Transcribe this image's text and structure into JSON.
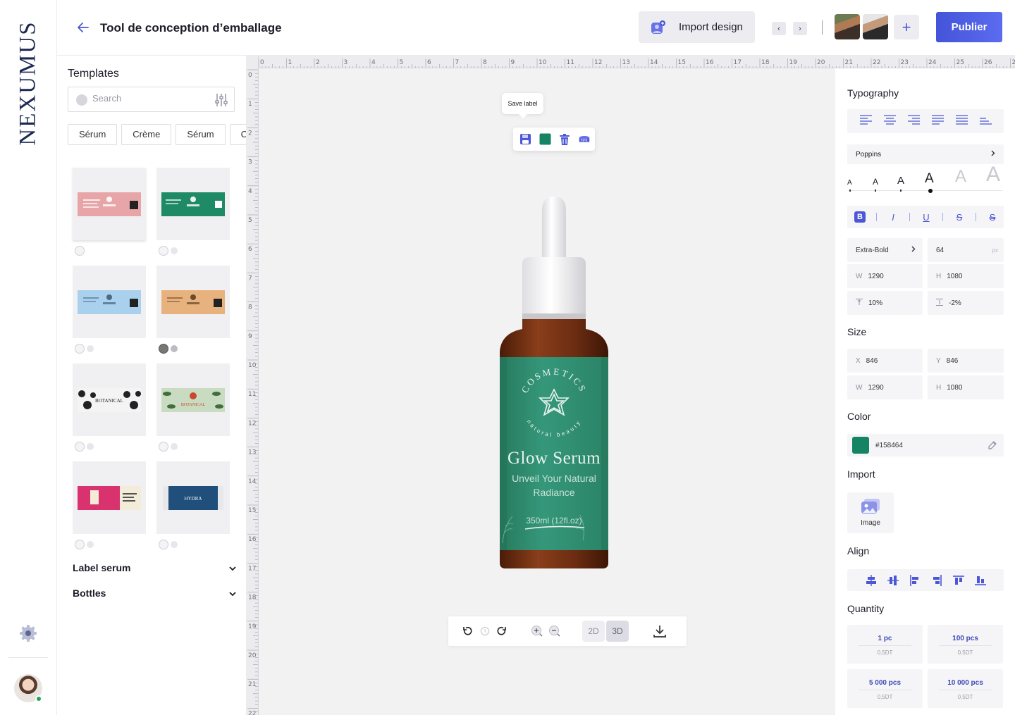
{
  "brand": {
    "logo_text": "NEXUMUS"
  },
  "header": {
    "title": "Tool de conception d’emballage",
    "import_label": "Import design",
    "prev_label": "‹",
    "next_label": "›",
    "add_label": "+",
    "publish_label": "Publier"
  },
  "templates": {
    "title": "Templates",
    "search_placeholder": "Search",
    "chips": [
      "Sérum",
      "Crème",
      "Sérum",
      "Crème"
    ],
    "cards": [
      {
        "color": "#e8a5a8"
      },
      {
        "color": "#1f8b66"
      },
      {
        "color": "#a9d0ec"
      },
      {
        "color": "#e8b27e"
      },
      {
        "color": "#f4f4f4",
        "text": "BOTANICAL"
      },
      {
        "color": "#c9dcc1",
        "text": "BOTANICAL"
      },
      {
        "color": "#d8336e"
      },
      {
        "color": "#1f4f7a",
        "text": "HYDRA"
      }
    ],
    "accordions": [
      {
        "label": "Label serum"
      },
      {
        "label": "Bottles"
      }
    ]
  },
  "ruler": {
    "top_max": 27,
    "left_max": 22
  },
  "canvas": {
    "tooltip": "Save label",
    "label": {
      "brand_arc": "COSMETICS",
      "tagline_arc": "natural beauty",
      "title": "Glow Serum",
      "subtitle_line1": "Unveil Your Natural",
      "subtitle_line2": "Radiance",
      "volume": "350ml (12fl.oz)"
    },
    "view_modes": {
      "two_d": "2D",
      "three_d": "3D",
      "active": "3D"
    }
  },
  "properties": {
    "typography": {
      "title": "Typography",
      "font_family": "Poppins",
      "size_letter": "A",
      "selected_size_index": 3,
      "weight": "Extra-Bold",
      "font_size": "64",
      "font_size_unit": "px",
      "w_label": "W",
      "w_value": "1290",
      "h_label": "H",
      "h_value": "1080",
      "line_height": "10%",
      "letter_spacing": "-2%",
      "styles": {
        "bold": "B",
        "italic": "I",
        "underline": "U",
        "strike": "S",
        "strike2": "S"
      }
    },
    "size": {
      "title": "Size",
      "x_label": "X",
      "x_value": "846",
      "y_label": "Y",
      "y_value": "846",
      "w_label": "W",
      "w_value": "1290",
      "h_label": "H",
      "h_value": "1080"
    },
    "color": {
      "title": "Color",
      "hex": "#158464"
    },
    "import": {
      "title": "Import",
      "image_label": "Image"
    },
    "align": {
      "title": "Align"
    },
    "quantity": {
      "title": "Quantity",
      "options": [
        {
          "qty": "1 pc",
          "price": "0,5DT"
        },
        {
          "qty": "100 pcs",
          "price": "0,5DT"
        },
        {
          "qty": "5 000 pcs",
          "price": "0,5DT"
        },
        {
          "qty": "10 000 pcs",
          "price": "0,5DT"
        }
      ]
    }
  },
  "colors": {
    "accent": "#4b57d6",
    "label_green": "#2f8f6d",
    "bottle_amber": "#6b2c12"
  }
}
